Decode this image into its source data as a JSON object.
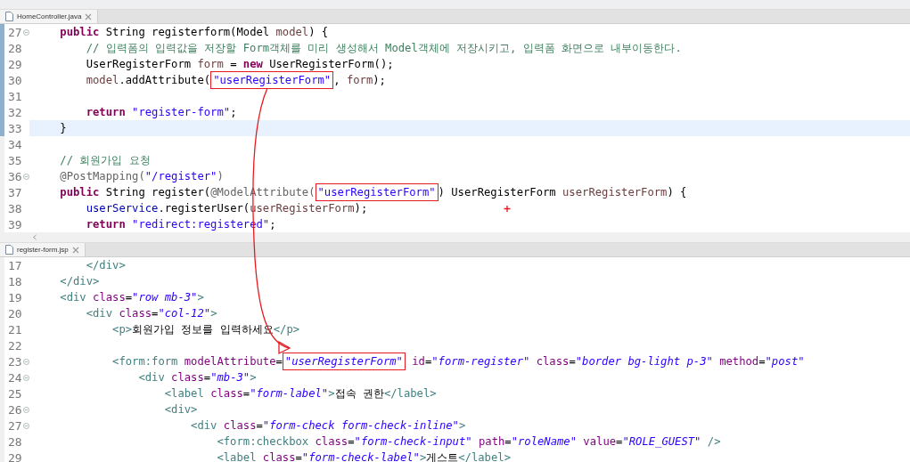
{
  "editors": [
    {
      "tab": {
        "label": "HomeController.java"
      },
      "lines": [
        {
          "number": "27",
          "foldable": true,
          "current": false,
          "in_range": true,
          "tokens": [
            {
              "kind": "keyword",
              "text": "    public"
            },
            {
              "kind": "plain",
              "text": " String registerform(Model "
            },
            {
              "kind": "variable",
              "text": "model"
            },
            {
              "kind": "plain",
              "text": ") {"
            }
          ]
        },
        {
          "number": "28",
          "foldable": false,
          "current": false,
          "in_range": true,
          "tokens": [
            {
              "kind": "comment",
              "text": "        // 입력폼의 입력값을 저장할 Form객체를 미리 생성해서 Model객체에 저장시키고, 입력폼 화면으로 내부이동한다."
            }
          ]
        },
        {
          "number": "29",
          "foldable": false,
          "current": false,
          "in_range": true,
          "tokens": [
            {
              "kind": "plain",
              "text": "        UserRegisterForm "
            },
            {
              "kind": "variable",
              "text": "form"
            },
            {
              "kind": "plain",
              "text": " = "
            },
            {
              "kind": "keyword",
              "text": "new"
            },
            {
              "kind": "plain",
              "text": " UserRegisterForm();"
            }
          ]
        },
        {
          "number": "30",
          "foldable": false,
          "current": false,
          "in_range": true,
          "tokens": [
            {
              "kind": "variable",
              "text": "        model"
            },
            {
              "kind": "plain",
              "text": ".addAttribute("
            },
            {
              "kind": "string",
              "text": "\"userRegisterForm\"",
              "boxed": true
            },
            {
              "kind": "plain",
              "text": ", "
            },
            {
              "kind": "variable",
              "text": "form"
            },
            {
              "kind": "plain",
              "text": ");"
            }
          ]
        },
        {
          "number": "31",
          "foldable": false,
          "current": false,
          "in_range": true
        },
        {
          "number": "32",
          "foldable": false,
          "current": false,
          "in_range": true,
          "tokens": [
            {
              "kind": "keyword",
              "text": "        return "
            },
            {
              "kind": "string",
              "text": "\"register-form\""
            },
            {
              "kind": "plain",
              "text": ";"
            }
          ]
        },
        {
          "number": "33",
          "foldable": false,
          "current": true,
          "in_range": true,
          "tokens": [
            {
              "kind": "plain",
              "text": "    }"
            }
          ]
        },
        {
          "number": "34",
          "foldable": false,
          "current": false,
          "in_range": false
        },
        {
          "number": "35",
          "foldable": false,
          "current": false,
          "in_range": false,
          "tokens": [
            {
              "kind": "comment",
              "text": "    // 회원가입 요청"
            }
          ]
        },
        {
          "number": "36",
          "foldable": true,
          "current": false,
          "in_range": false,
          "tokens": [
            {
              "kind": "annotation",
              "text": "    @PostMapping("
            },
            {
              "kind": "string",
              "text": "\"/register\""
            },
            {
              "kind": "annotation",
              "text": ")"
            }
          ]
        },
        {
          "number": "37",
          "foldable": false,
          "current": false,
          "in_range": false,
          "tokens": [
            {
              "kind": "keyword",
              "text": "    public"
            },
            {
              "kind": "plain",
              "text": " String register("
            },
            {
              "kind": "annotation",
              "text": "@ModelAttribute("
            },
            {
              "kind": "string",
              "text": "\"userRegisterForm\"",
              "boxed": true
            },
            {
              "kind": "plain",
              "text": ") UserRegisterForm "
            },
            {
              "kind": "variable",
              "text": "userRegisterForm"
            },
            {
              "kind": "plain",
              "text": ") {"
            }
          ]
        },
        {
          "number": "38",
          "foldable": false,
          "current": false,
          "in_range": false,
          "tokens": [
            {
              "kind": "field",
              "text": "        userService"
            },
            {
              "kind": "plain",
              "text": ".registerUser("
            },
            {
              "kind": "variable",
              "text": "userRegisterForm"
            },
            {
              "kind": "plain",
              "text": ");"
            }
          ]
        },
        {
          "number": "39",
          "foldable": false,
          "current": false,
          "in_range": false,
          "tokens": [
            {
              "kind": "keyword",
              "text": "        return "
            },
            {
              "kind": "string",
              "text": "\"redirect:registered\""
            },
            {
              "kind": "plain",
              "text": ";"
            }
          ]
        }
      ]
    },
    {
      "tab": {
        "label": "register-form.jsp"
      },
      "lines": [
        {
          "number": "17",
          "foldable": false,
          "current": false,
          "tokens": [
            {
              "kind": "tag",
              "text": "        </div>"
            }
          ]
        },
        {
          "number": "18",
          "foldable": false,
          "current": false,
          "tokens": [
            {
              "kind": "tag",
              "text": "    </div>"
            }
          ]
        },
        {
          "number": "19",
          "foldable": false,
          "current": false,
          "tokens": [
            {
              "kind": "tag",
              "text": "    <div "
            },
            {
              "kind": "attr",
              "text": "class"
            },
            {
              "kind": "plain",
              "text": "="
            },
            {
              "kind": "value",
              "text": "\"row mb-3\""
            },
            {
              "kind": "tag",
              "text": ">"
            }
          ]
        },
        {
          "number": "20",
          "foldable": false,
          "current": false,
          "tokens": [
            {
              "kind": "tag",
              "text": "        <div "
            },
            {
              "kind": "attr",
              "text": "class"
            },
            {
              "kind": "plain",
              "text": "="
            },
            {
              "kind": "value",
              "text": "\"col-12\""
            },
            {
              "kind": "tag",
              "text": ">"
            }
          ]
        },
        {
          "number": "21",
          "foldable": false,
          "current": false,
          "tokens": [
            {
              "kind": "tag",
              "text": "            <p>"
            },
            {
              "kind": "plain",
              "text": "회원가입 정보를 입력하세요"
            },
            {
              "kind": "tag",
              "text": "</p>"
            }
          ]
        },
        {
          "number": "22",
          "foldable": false,
          "current": false
        },
        {
          "number": "23",
          "foldable": true,
          "current": false,
          "tokens": [
            {
              "kind": "tag",
              "text": "            <form:form "
            },
            {
              "kind": "attr",
              "text": "modelAttribute"
            },
            {
              "kind": "plain",
              "text": "="
            },
            {
              "kind": "value",
              "text": "\"userRegisterForm\"",
              "boxed": true
            },
            {
              "kind": "attr",
              "text": " id"
            },
            {
              "kind": "plain",
              "text": "="
            },
            {
              "kind": "value",
              "text": "\"form-register\""
            },
            {
              "kind": "attr",
              "text": " class"
            },
            {
              "kind": "plain",
              "text": "="
            },
            {
              "kind": "value",
              "text": "\"border bg-light p-3\""
            },
            {
              "kind": "attr",
              "text": " method"
            },
            {
              "kind": "plain",
              "text": "="
            },
            {
              "kind": "value",
              "text": "\"post\""
            }
          ]
        },
        {
          "number": "24",
          "foldable": true,
          "current": false,
          "tokens": [
            {
              "kind": "tag",
              "text": "                <div "
            },
            {
              "kind": "attr",
              "text": "class"
            },
            {
              "kind": "plain",
              "text": "="
            },
            {
              "kind": "value",
              "text": "\"mb-3\""
            },
            {
              "kind": "tag",
              "text": ">"
            }
          ]
        },
        {
          "number": "25",
          "foldable": false,
          "current": false,
          "tokens": [
            {
              "kind": "tag",
              "text": "                    <label "
            },
            {
              "kind": "attr",
              "text": "class"
            },
            {
              "kind": "plain",
              "text": "="
            },
            {
              "kind": "value",
              "text": "\"form-label\""
            },
            {
              "kind": "tag",
              "text": ">"
            },
            {
              "kind": "plain",
              "text": "접속 권한"
            },
            {
              "kind": "tag",
              "text": "</label>"
            }
          ]
        },
        {
          "number": "26",
          "foldable": true,
          "current": false,
          "tokens": [
            {
              "kind": "tag",
              "text": "                    <div>"
            }
          ]
        },
        {
          "number": "27",
          "foldable": true,
          "current": false,
          "tokens": [
            {
              "kind": "tag",
              "text": "                        <div "
            },
            {
              "kind": "attr",
              "text": "class"
            },
            {
              "kind": "plain",
              "text": "="
            },
            {
              "kind": "value",
              "text": "\"form-check form-check-inline\""
            },
            {
              "kind": "tag",
              "text": ">"
            }
          ]
        },
        {
          "number": "28",
          "foldable": false,
          "current": false,
          "tokens": [
            {
              "kind": "tag",
              "text": "                            <form:checkbox "
            },
            {
              "kind": "attr",
              "text": "class"
            },
            {
              "kind": "plain",
              "text": "="
            },
            {
              "kind": "value",
              "text": "\"form-check-input\""
            },
            {
              "kind": "attr",
              "text": " path"
            },
            {
              "kind": "plain",
              "text": "="
            },
            {
              "kind": "value",
              "text": "\"roleName\""
            },
            {
              "kind": "attr",
              "text": " value"
            },
            {
              "kind": "plain",
              "text": "="
            },
            {
              "kind": "value",
              "text": "\"ROLE_GUEST\""
            },
            {
              "kind": "tag",
              "text": " />"
            }
          ]
        },
        {
          "number": "29",
          "foldable": false,
          "current": false,
          "tokens": [
            {
              "kind": "tag",
              "text": "                            <label "
            },
            {
              "kind": "attr",
              "text": "class"
            },
            {
              "kind": "plain",
              "text": "="
            },
            {
              "kind": "value",
              "text": "\"form-check-label\""
            },
            {
              "kind": "tag",
              "text": ">"
            },
            {
              "kind": "plain",
              "text": "게스트"
            },
            {
              "kind": "tag",
              "text": "</label>"
            }
          ]
        }
      ]
    }
  ]
}
